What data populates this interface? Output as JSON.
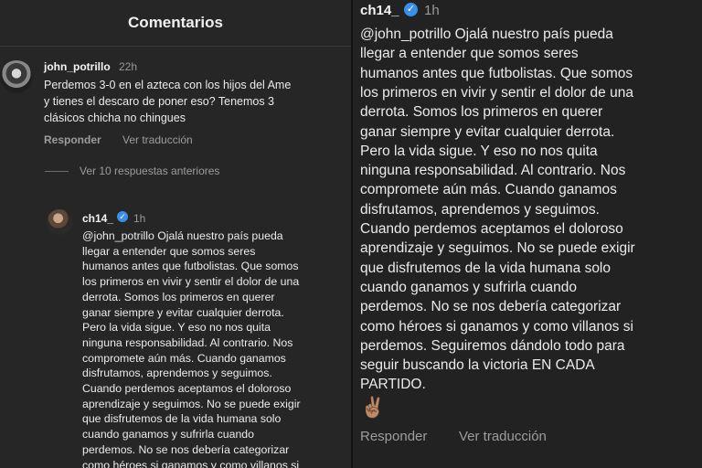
{
  "header": {
    "title": "Comentarios"
  },
  "comment1": {
    "username": "john_potrillo",
    "time": "22h",
    "lines": [
      "Perdemos 3-0 en el azteca con los hijos del Ame",
      "y tienes el descaro de poner eso? Tenemos 3",
      "clásicos chicha no chingues"
    ],
    "reply_label": "Responder",
    "translate_label": "Ver traducción"
  },
  "view_replies": "Ver 10 respuestas anteriores",
  "reply": {
    "username": "ch14_",
    "verified": true,
    "time": "1h",
    "lines_left": [
      "@john_potrillo Ojalá nuestro país pueda",
      "llegar a entender que somos seres",
      "humanos antes que futbolistas. Que somos",
      "los primeros en vivir y sentir el dolor de una",
      "derrota. Somos los primeros en querer",
      "ganar siempre y evitar cualquier derrota.",
      "Pero la vida sigue. Y eso no nos quita",
      "ninguna responsabilidad. Al contrario. Nos",
      "compromete aún más. Cuando ganamos",
      "disfrutamos, aprendemos y seguimos.",
      "Cuando perdemos aceptamos el doloroso",
      "aprendizaje y seguimos. No se puede exigir",
      "que disfrutemos de la vida humana solo",
      "cuando ganamos y sufrirla cuando",
      "perdemos. No se nos debería categorizar",
      "como héroes si ganamos y como villanos si"
    ],
    "lines_right": [
      "@john_potrillo Ojalá nuestro país pueda",
      "llegar a entender que somos seres",
      "humanos antes que futbolistas. Que somos",
      "los primeros en vivir y sentir el dolor de una",
      "derrota. Somos los primeros en querer",
      "ganar siempre y evitar cualquier derrota.",
      "Pero la vida sigue. Y eso no nos quita",
      "ninguna responsabilidad. Al contrario. Nos",
      "compromete aún más. Cuando ganamos",
      "disfrutamos, aprendemos y seguimos.",
      "Cuando perdemos aceptamos el doloroso",
      "aprendizaje y seguimos. No se puede exigir",
      "que disfrutemos de la vida humana solo",
      "cuando ganamos y sufrirla cuando",
      "perdemos. No se nos debería categorizar",
      "como héroes si ganamos y como villanos si",
      "perdemos. Seguiremos dándolo todo para",
      "seguir buscando la victoria EN CADA",
      "PARTIDO."
    ],
    "emoji": "✌🏽",
    "reply_label": "Responder",
    "translate_label": "Ver traducción"
  }
}
